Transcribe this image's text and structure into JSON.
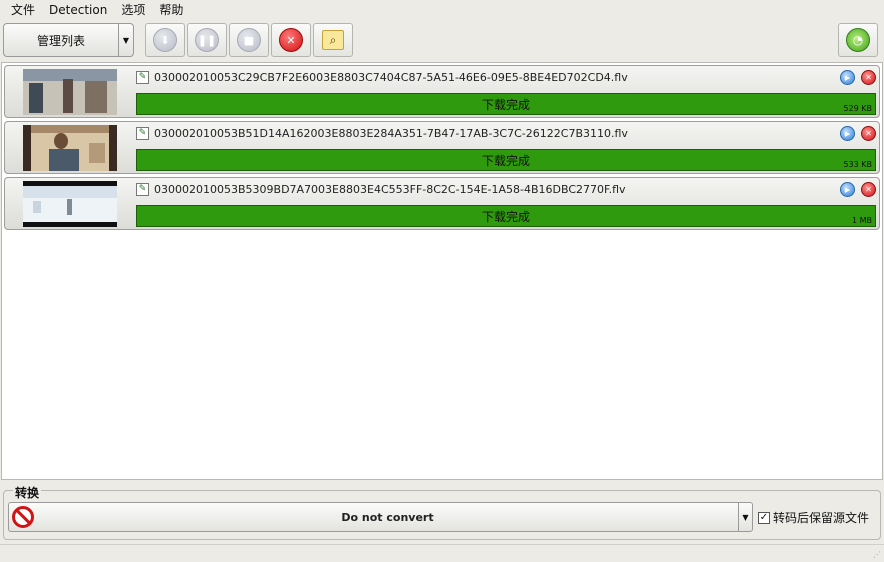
{
  "menu": [
    "文件",
    "Detection",
    "选项",
    "帮助"
  ],
  "toolbar": {
    "list_combo_label": "管理列表",
    "buttons": [
      "download-icon",
      "pause-icon",
      "stop-icon",
      "delete-icon",
      "search-icon"
    ],
    "radar_icon": "radar-icon"
  },
  "downloads": [
    {
      "filename": "030002010053C29CB7F2E6003E8803C7404C87-5A51-46E6-09E5-8BE4ED702CD4.flv",
      "status": "下载完成",
      "size": "529 KB",
      "progress": 1.0,
      "thumb_colors": [
        "#3f4a55",
        "#8a96a3",
        "#c7c2b8"
      ]
    },
    {
      "filename": "030002010053B51D14A162003E8803E284A351-7B47-17AB-3C7C-26122C7B3110.flv",
      "status": "下载完成",
      "size": "533 KB",
      "progress": 1.0,
      "thumb_colors": [
        "#3a2a22",
        "#a58868",
        "#d9c6a7"
      ]
    },
    {
      "filename": "030002010053B5309BD7A7003E8803E4C553FF-8C2C-154E-1A58-4B16DBC2770F.flv",
      "status": "下载完成",
      "size": "1 MB",
      "progress": 1.0,
      "thumb_colors": [
        "#0f1012",
        "#d6e1ec",
        "#eef3f8"
      ]
    }
  ],
  "convert": {
    "title": "转换",
    "selected": "Do not convert",
    "keep_source_label": "转码后保留源文件",
    "keep_source_checked": true
  },
  "colors": {
    "progress_green": "#2f9a0e",
    "window_bg": "#ecebe6"
  }
}
